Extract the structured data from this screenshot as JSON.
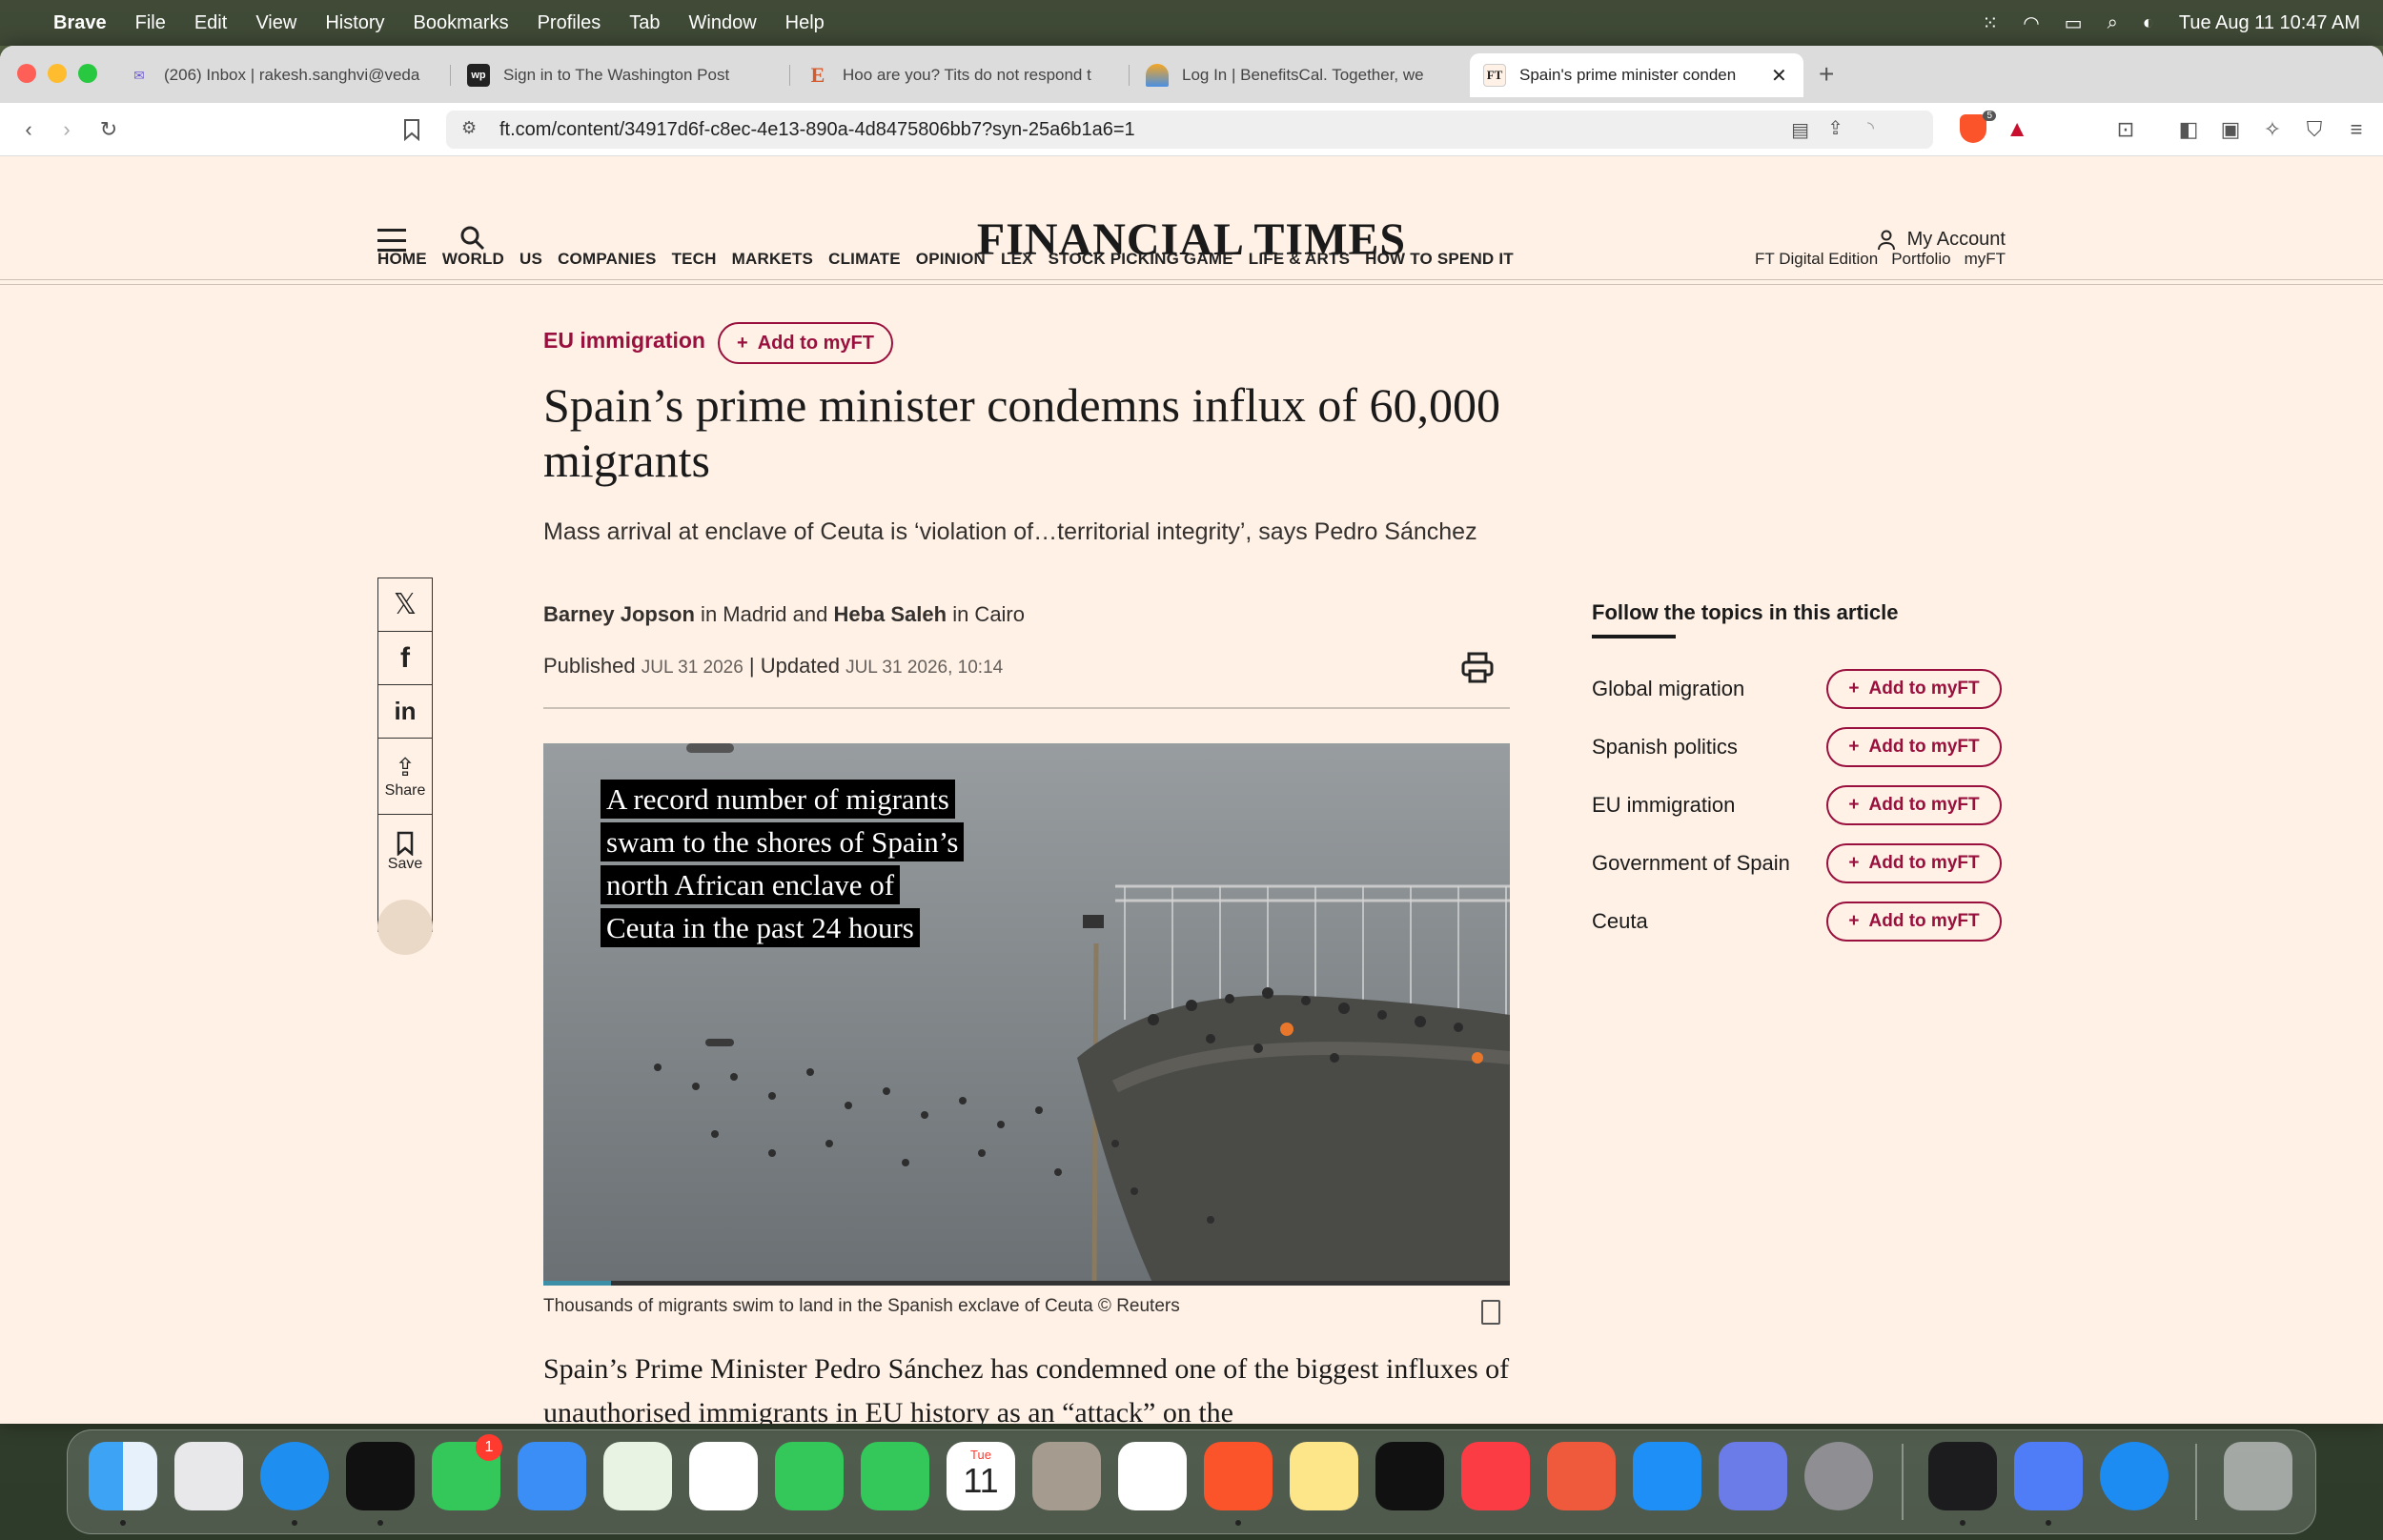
{
  "menubar": {
    "app": "Brave",
    "items": [
      "File",
      "Edit",
      "View",
      "History",
      "Bookmarks",
      "Profiles",
      "Tab",
      "Window",
      "Help"
    ],
    "datetime": "Tue Aug 11  10:47 AM"
  },
  "tabs": [
    {
      "title": "(206) Inbox | rakesh.sanghvi@veda",
      "favicon": "gmail-icon"
    },
    {
      "title": "Sign in to The Washington Post",
      "favicon": "wp-icon"
    },
    {
      "title": "Hoo are you? Tits do not respond t",
      "favicon": "e-icon"
    },
    {
      "title": "Log In | BenefitsCal. Together, we",
      "favicon": "benefitscal-icon"
    },
    {
      "title": "Spain's prime minister conden",
      "favicon": "ft-icon",
      "active": true
    }
  ],
  "tab_favicon_labels": {
    "wp": "wp",
    "e": "E",
    "ft": "FT"
  },
  "url": "ft.com/content/34917d6f-c8ec-4e13-890a-4d8475806bb7?syn-25a6b1a6=1",
  "brave_shield_count": "5",
  "ft": {
    "logo": "FINANCIAL TIMES",
    "account": "My Account",
    "nav": [
      "HOME",
      "WORLD",
      "US",
      "COMPANIES",
      "TECH",
      "MARKETS",
      "CLIMATE",
      "OPINION",
      "LEX",
      "STOCK PICKING GAME",
      "LIFE & ARTS",
      "HOW TO SPEND IT"
    ],
    "nav_right": [
      "FT Digital Edition",
      "Portfolio",
      "myFT"
    ]
  },
  "article": {
    "topic": "EU immigration",
    "add_label": "Add to myFT",
    "headline": "Spain’s prime minister condemns influx of 60,000 migrants",
    "standfirst": "Mass arrival at enclave of Ceuta is ‘violation of…territorial integrity’, says Pedro Sánchez",
    "author1": "Barney Jopson",
    "in1": " in Madrid and ",
    "author2": "Heba Saleh",
    "in2": " in Cairo",
    "published_label": "Published",
    "published_date": "JUL 31 2026",
    "updated_label": " | Updated",
    "updated_date": "JUL 31 2026, 10:14",
    "overlay_lines": [
      "A record number of migrants",
      "swam to the shores of Spain’s",
      "north African enclave of",
      "Ceuta in the past 24 hours"
    ],
    "video_progress": 0.07,
    "caption": "Thousands of migrants swim to land in the Spanish exclave of Ceuta © Reuters",
    "body": "Spain’s Prime Minister Pedro Sánchez has condemned one of the biggest influxes of unauthorised immigrants in EU history as an “attack” on the"
  },
  "share": {
    "share_label": "Share",
    "save_label": "Save"
  },
  "follow": {
    "title": "Follow the topics in this article",
    "topics": [
      "Global migration",
      "Spanish politics",
      "EU immigration",
      "Government of Spain",
      "Ceuta"
    ]
  },
  "dock": {
    "calendar_month": "Tue",
    "calendar_day": "11",
    "messages_badge": "1"
  }
}
